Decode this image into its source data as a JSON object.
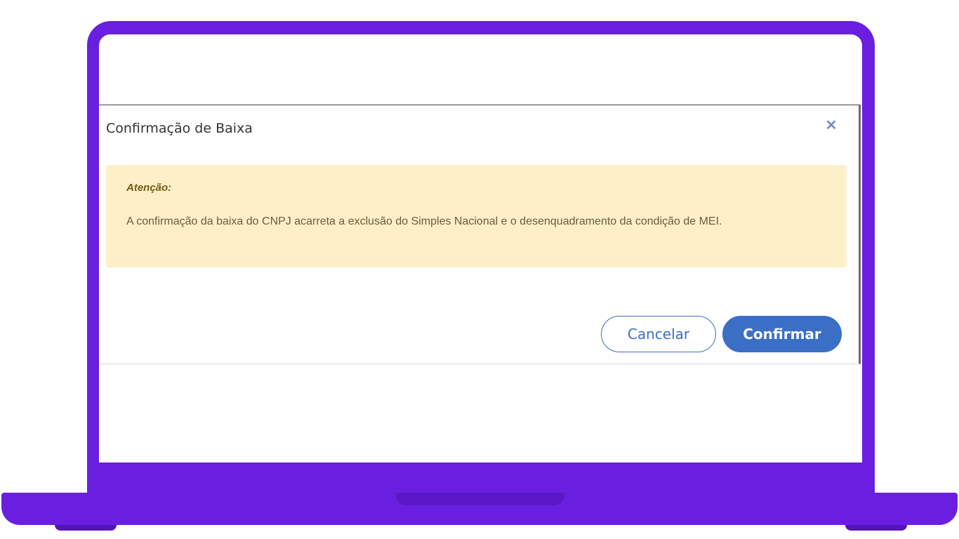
{
  "dialog": {
    "title": "Confirmação de Baixa",
    "close_icon": "close-icon",
    "alert": {
      "heading": "Atenção:",
      "text": "A confirmação da baixa do CNPJ acarreta a exclusão do Simples Nacional e o desenquadramento da condição de MEI."
    },
    "buttons": {
      "cancel_label": "Cancelar",
      "confirm_label": "Confirmar"
    }
  },
  "colors": {
    "laptop_frame": "#6a1fe0",
    "primary": "#3a6fc5",
    "alert_background": "#fdf0c8"
  }
}
